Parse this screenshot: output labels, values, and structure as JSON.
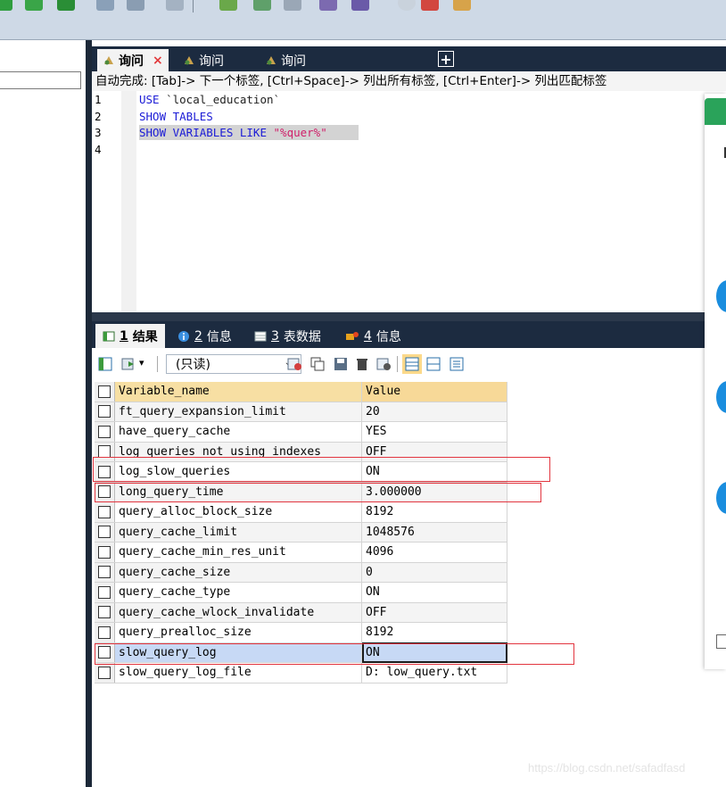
{
  "editor": {
    "tabs": [
      {
        "label": "询问",
        "active": true,
        "closable": true
      },
      {
        "label": "询问",
        "active": false,
        "closable": false
      },
      {
        "label": "询问",
        "active": false,
        "closable": false
      }
    ],
    "add_tab_label": "+",
    "close_glyph": "×",
    "autocomplete_hint": "自动完成: [Tab]-> 下一个标签, [Ctrl+Space]-> 列出所有标签, [Ctrl+Enter]-> 列出匹配标签",
    "line_numbers": [
      "1",
      "2",
      "3",
      "4"
    ],
    "code": {
      "line1_kw": "USE",
      "line1_rest": " `local_education`",
      "line2": "SHOW TABLES",
      "line3_kw": "SHOW VARIABLES LIKE ",
      "line3_lit": "\"%quer%\""
    }
  },
  "results": {
    "tabs": [
      {
        "num": "1",
        "label": "结果",
        "active": true,
        "icon": "result-grid-icon"
      },
      {
        "num": "2",
        "label": "信息",
        "active": false,
        "icon": "info-icon"
      },
      {
        "num": "3",
        "label": "表数据",
        "active": false,
        "icon": "table-data-icon"
      },
      {
        "num": "4",
        "label": "信息",
        "active": false,
        "icon": "info-icon"
      }
    ],
    "toolbar": {
      "mode_select": "(只读)",
      "mode_caret": "⌵"
    },
    "columns": [
      "Variable_name",
      "Value"
    ],
    "rows": [
      [
        "ft_query_expansion_limit",
        "20"
      ],
      [
        "have_query_cache",
        "YES"
      ],
      [
        "log_queries_not_using_indexes",
        "OFF"
      ],
      [
        "log_slow_queries",
        "ON"
      ],
      [
        "long_query_time",
        "3.000000"
      ],
      [
        "query_alloc_block_size",
        "8192"
      ],
      [
        "query_cache_limit",
        "1048576"
      ],
      [
        "query_cache_min_res_unit",
        "4096"
      ],
      [
        "query_cache_size",
        "0"
      ],
      [
        "query_cache_type",
        "ON"
      ],
      [
        "query_cache_wlock_invalidate",
        "OFF"
      ],
      [
        "query_prealloc_size",
        "8192"
      ],
      [
        "slow_query_log",
        "ON"
      ],
      [
        "slow_query_log_file",
        "D: low_query.txt"
      ]
    ],
    "highlighted_rows": [
      "log_slow_queries",
      "long_query_time",
      "slow_query_log"
    ],
    "selected_row": "slow_query_log"
  },
  "watermark": "https://blog.csdn.net/safadfasd",
  "colors": {
    "dark_tab_strip": "#1c2b40",
    "keyword_blue": "#1b1bd6",
    "string_literal": "#d0206a",
    "header_gold": "#f7dfa3",
    "highlight_red": "#e2353f",
    "selection_blue": "#c7d9f5"
  }
}
